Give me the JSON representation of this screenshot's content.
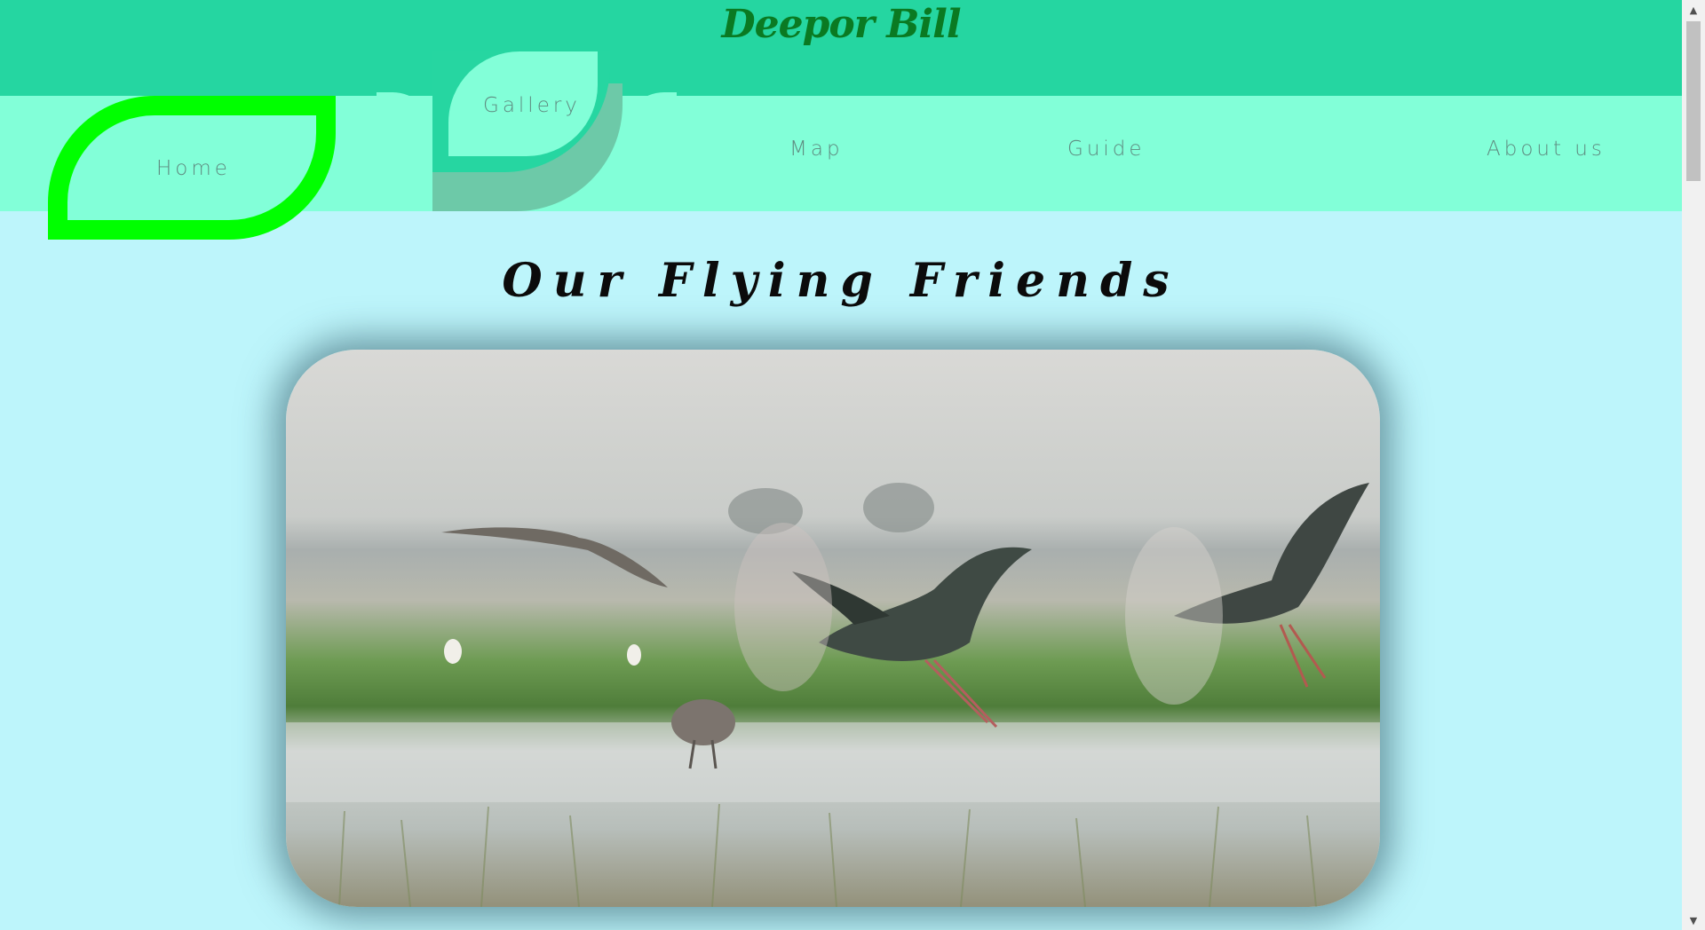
{
  "header": {
    "brand": "Deepor Bill"
  },
  "nav": {
    "home": "Home",
    "gallery": "Gallery",
    "map": "Map",
    "guide": "Guide",
    "about": "About us"
  },
  "main": {
    "heading": "Our Flying Friends",
    "hero_image_alt": "storks and herons taking flight over wetland"
  },
  "colors": {
    "header_bg": "#25d6a1",
    "nav_bg": "#82ffd8",
    "page_bg": "#bdf5fb",
    "active_outline": "#00ff00",
    "brand_text": "#0a7a22"
  },
  "icons": {
    "scroll_up": "chevron-up-icon",
    "scroll_down": "chevron-down-icon"
  }
}
